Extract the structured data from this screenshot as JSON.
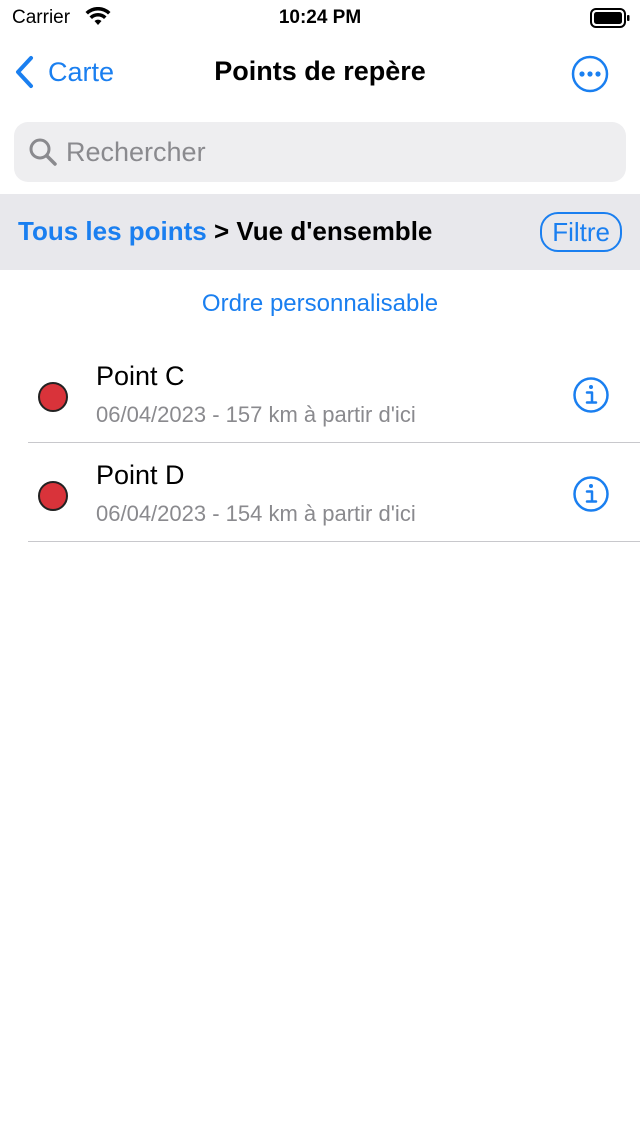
{
  "status_bar": {
    "carrier": "Carrier",
    "time": "10:24 PM",
    "wifi_icon": "wifi-icon",
    "battery_icon": "battery-icon"
  },
  "nav": {
    "back_label": "Carte",
    "title": "Points de repère",
    "more_icon": "ellipsis-circle-icon"
  },
  "search": {
    "placeholder": "Rechercher",
    "value": ""
  },
  "breadcrumb": {
    "root": "Tous les points",
    "separator": ">",
    "current": "Vue d'ensemble",
    "filter_label": "Filtre"
  },
  "custom_order_label": "Ordre personnalisable",
  "items": [
    {
      "title": "Point C",
      "subtitle": "06/04/2023 - 157 km à partir d'ici",
      "color": "#d9333a"
    },
    {
      "title": "Point D",
      "subtitle": "06/04/2023 - 154 km à partir d'ici",
      "color": "#d9333a"
    }
  ],
  "colors": {
    "accent": "#1a7ff0",
    "marker": "#d9333a",
    "secondary_text": "#8a8a8e"
  }
}
